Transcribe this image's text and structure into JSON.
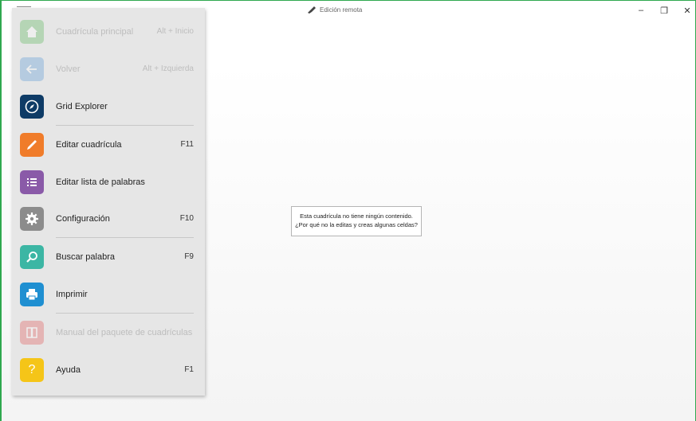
{
  "window": {
    "title": "Edición remota",
    "minimize": "–",
    "restore": "❐",
    "close": "✕"
  },
  "menu": {
    "items": [
      {
        "label": "Cuadrícula principal",
        "shortcut": "Alt + Inicio",
        "icon": "home-icon",
        "color": "#5cb85c",
        "enabled": false
      },
      {
        "label": "Volver",
        "shortcut": "Alt + Izquierda",
        "icon": "back-arrow-icon",
        "color": "#5b9bd5",
        "enabled": false
      },
      {
        "label": "Grid Explorer",
        "shortcut": "",
        "icon": "compass-icon",
        "color": "#0e3b66",
        "enabled": true
      },
      {
        "label": "Editar cuadrícula",
        "shortcut": "F11",
        "icon": "pencil-icon",
        "color": "#f07c2a",
        "enabled": true
      },
      {
        "label": "Editar lista de palabras",
        "shortcut": "",
        "icon": "list-icon",
        "color": "#8a5aa8",
        "enabled": true
      },
      {
        "label": "Configuración",
        "shortcut": "F10",
        "icon": "gear-icon",
        "color": "#8c8c8c",
        "enabled": true
      },
      {
        "label": "Buscar palabra",
        "shortcut": "F9",
        "icon": "search-icon",
        "color": "#3cb6a4",
        "enabled": true
      },
      {
        "label": "Imprimir",
        "shortcut": "",
        "icon": "printer-icon",
        "color": "#1f8fd1",
        "enabled": true
      },
      {
        "label": "Manual del paquete de cuadrículas",
        "shortcut": "",
        "icon": "book-icon",
        "color": "#e35a5a",
        "enabled": false
      },
      {
        "label": "Ayuda",
        "shortcut": "F1",
        "icon": "help-icon",
        "color": "#f5c518",
        "enabled": true
      }
    ]
  },
  "message": {
    "line1": "Esta cuadrícula no tiene ningún contenido.",
    "line2": "¿Por qué no la editas y creas algunas celdas?"
  }
}
